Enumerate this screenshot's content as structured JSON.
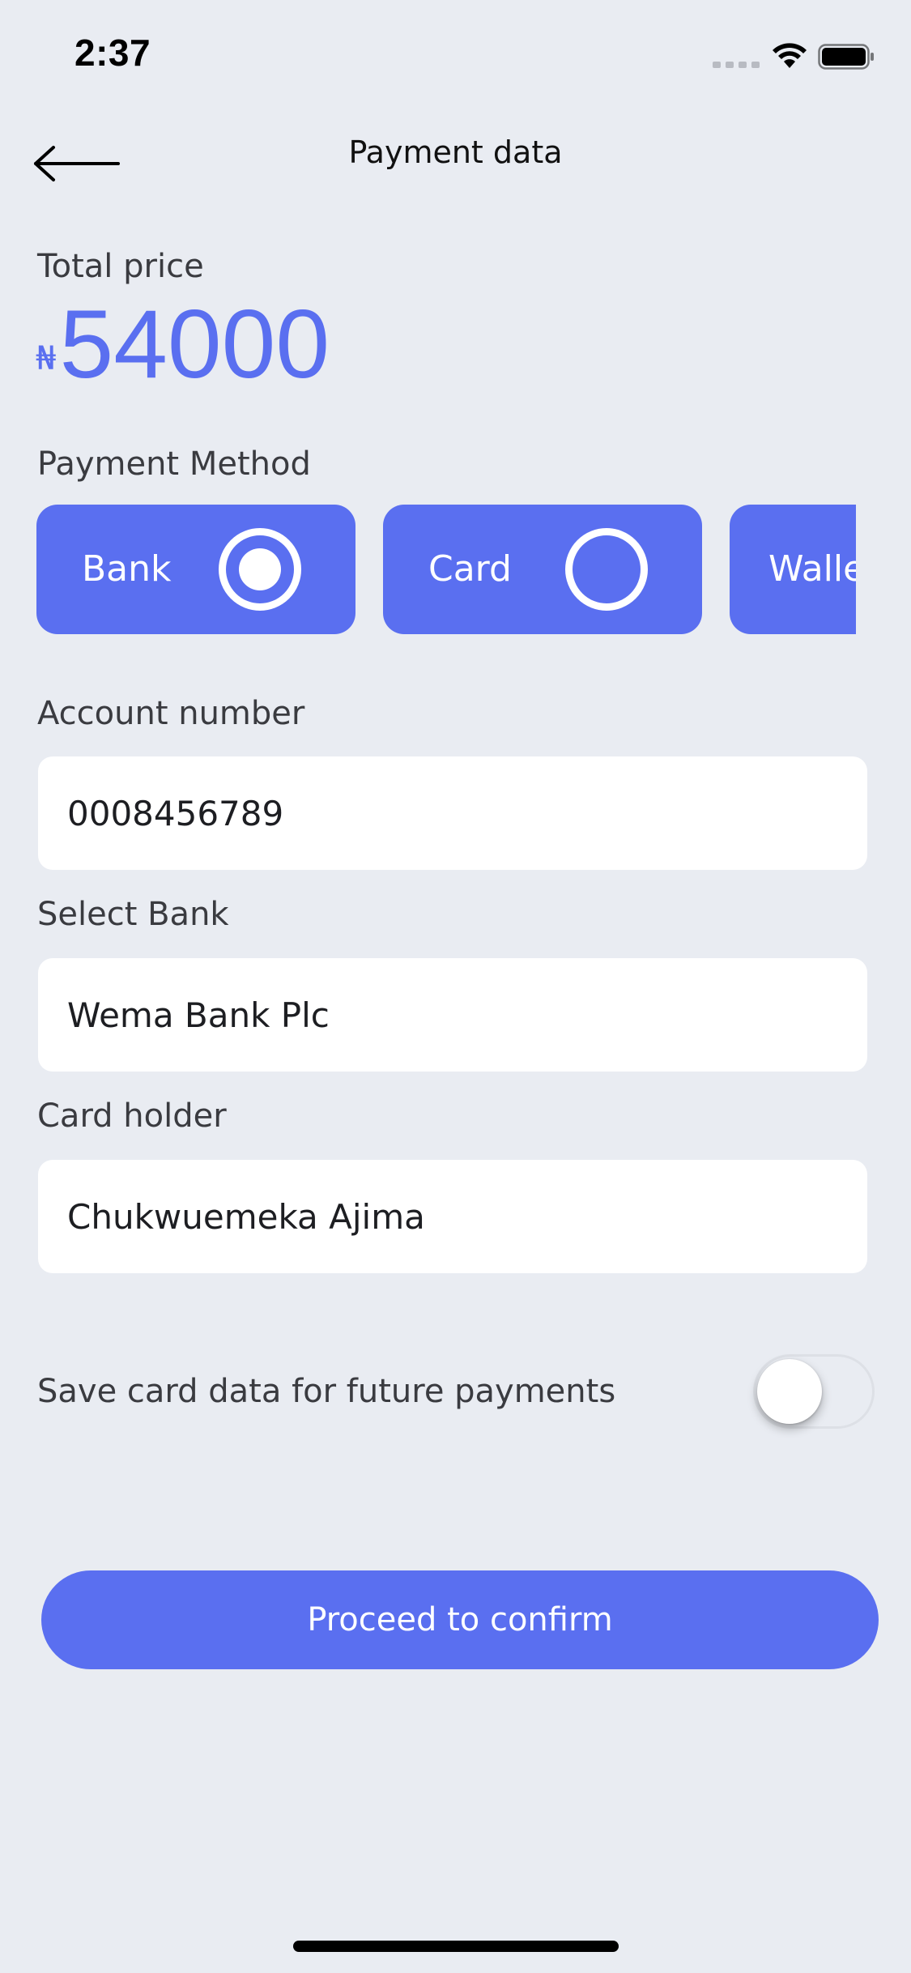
{
  "status_bar": {
    "time": "2:37",
    "icons": [
      "signal-icon",
      "wifi-icon",
      "battery-icon"
    ]
  },
  "header": {
    "back_icon": "arrow-left-icon",
    "title": "Payment data"
  },
  "price": {
    "label": "Total price",
    "currency": "₦",
    "amount": "54000"
  },
  "payment_method": {
    "label": "Payment Method",
    "options": [
      {
        "label": "Bank",
        "selected": true
      },
      {
        "label": "Card",
        "selected": false
      },
      {
        "label": "Wallet",
        "selected": false
      }
    ]
  },
  "fields": {
    "account_number": {
      "label": "Account number",
      "value": "0008456789"
    },
    "bank": {
      "label": "Select Bank",
      "value": "Wema Bank Plc"
    },
    "card_holder": {
      "label": "Card holder",
      "value": "Chukwuemeka Ajima"
    }
  },
  "save_card": {
    "label": "Save card data for future payments",
    "enabled": false
  },
  "proceed_label": "Proceed to confirm",
  "colors": {
    "accent": "#5a6ff0",
    "background": "#e9ecf2",
    "field_background": "#ffffff"
  }
}
